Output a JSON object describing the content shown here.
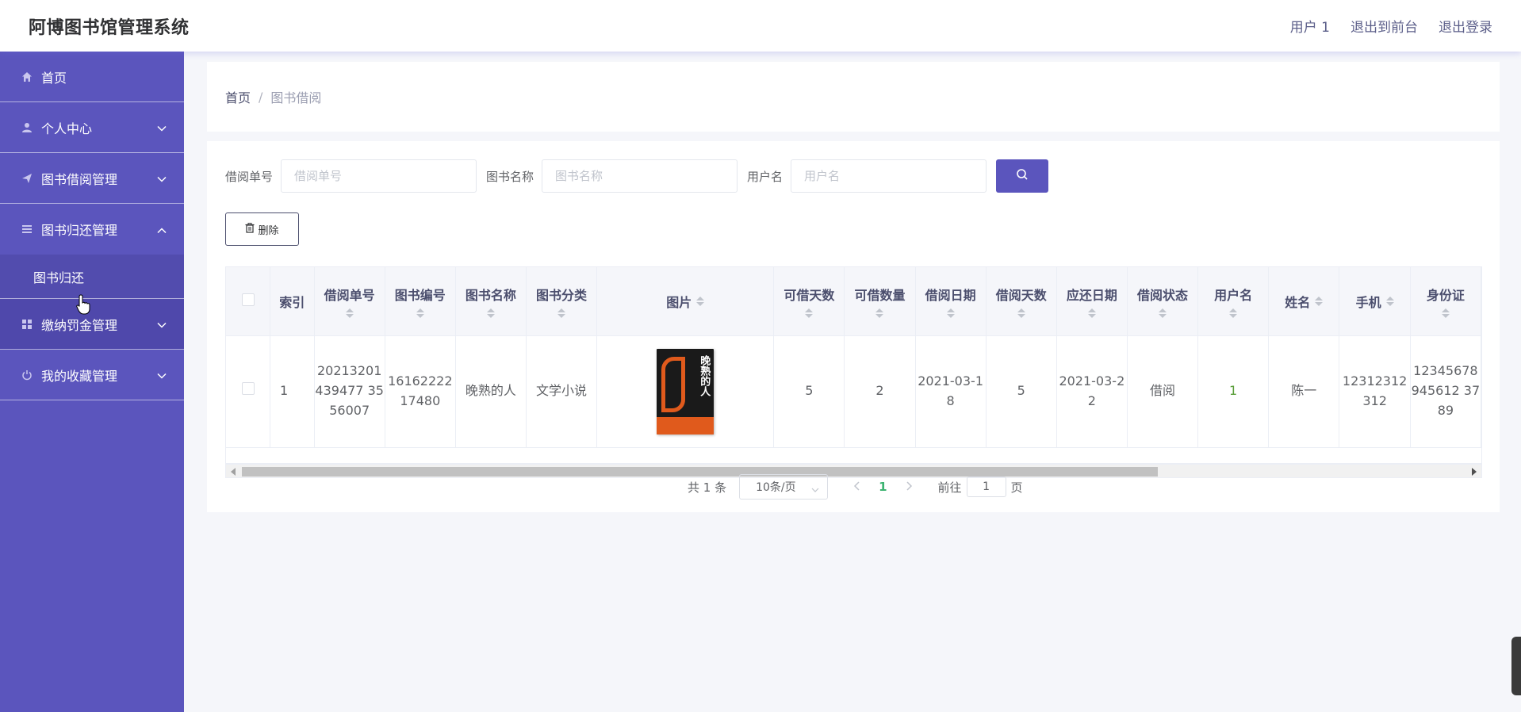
{
  "header": {
    "title": "阿博图书馆管理系统",
    "user_label": "用户 1",
    "front_label": "退出到前台",
    "logout_label": "退出登录"
  },
  "sidebar": {
    "items": [
      {
        "label": "首页",
        "icon": "home-icon"
      },
      {
        "label": "个人中心",
        "icon": "user-icon"
      },
      {
        "label": "图书借阅管理",
        "icon": "send-icon"
      },
      {
        "label": "图书归还管理",
        "icon": "menu-icon"
      },
      {
        "label": "缴纳罚金管理",
        "icon": "grid-icon"
      },
      {
        "label": "我的收藏管理",
        "icon": "power-icon"
      }
    ],
    "sub_item": "图书归还"
  },
  "breadcrumb": {
    "home": "首页",
    "separator": "/",
    "current": "图书借阅"
  },
  "search": {
    "fields": [
      {
        "label": "借阅单号",
        "placeholder": "借阅单号"
      },
      {
        "label": "图书名称",
        "placeholder": "图书名称"
      },
      {
        "label": "用户名",
        "placeholder": "用户名"
      }
    ]
  },
  "toolbar": {
    "delete_label": "删除"
  },
  "table": {
    "columns": [
      "索引",
      "借阅单号",
      "图书编号",
      "图书名称",
      "图书分类",
      "图片",
      "可借天数",
      "可借数量",
      "借阅日期",
      "借阅天数",
      "应还日期",
      "借阅状态",
      "用户名",
      "姓名",
      "手机",
      "身份证"
    ],
    "rows": [
      {
        "index": "1",
        "order_no": "20213201439477 3556007",
        "book_no": "1616222217480",
        "book_name": "晚熟的人",
        "category": "文学小说",
        "image": "book-cover",
        "loan_days_allowed": "5",
        "available_qty": "2",
        "borrow_date": "2021-03-18",
        "borrow_days": "5",
        "due_date": "2021-03-22",
        "status": "借阅",
        "username": "1",
        "name": "陈一",
        "phone": "12312312312",
        "id_card": "12345678945612 3789"
      }
    ]
  },
  "pagination": {
    "total": "共 1 条",
    "page_size": "10条/页",
    "current_page": "1",
    "goto_prefix": "前往",
    "goto_value": "1",
    "goto_suffix": "页"
  },
  "colors": {
    "sidebar": "#5b55bd",
    "accent": "#5b55bd",
    "active_page": "#3cb371"
  }
}
